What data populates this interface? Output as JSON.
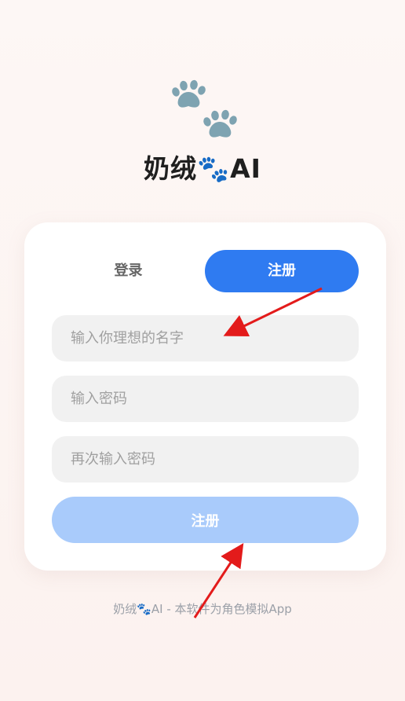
{
  "brand": {
    "title": "奶绒🐾AI"
  },
  "auth": {
    "tabs": {
      "login": "登录",
      "register": "注册"
    },
    "active_tab": "register",
    "fields": {
      "name_placeholder": "输入你理想的名字",
      "name_value": "",
      "password_placeholder": "输入密码",
      "password_value": "",
      "confirm_placeholder": "再次输入密码",
      "confirm_value": ""
    },
    "submit_label": "注册"
  },
  "footer": {
    "text": "奶绒🐾AI - 本软件为角色模拟App"
  },
  "colors": {
    "accent": "#2f7bf1",
    "submit_disabled": "#a9cbfb",
    "paw": "#7ea3b1",
    "annotation_arrow": "#e31b1b"
  },
  "icons": {
    "logo": "paw-prints-icon"
  }
}
